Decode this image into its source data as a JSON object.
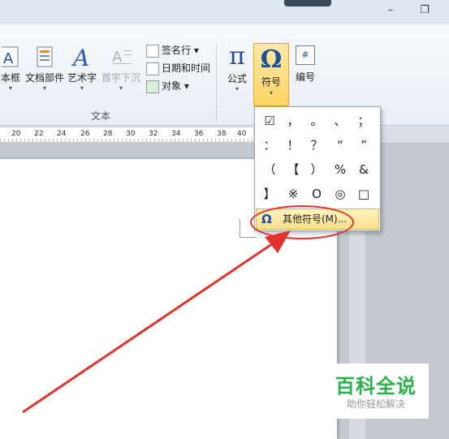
{
  "window": {
    "minimize_glyph": "–",
    "restore_glyph": "❐"
  },
  "ribbon": {
    "buttons": [
      {
        "label": "本框",
        "icon": "textbox-icon"
      },
      {
        "label": "文档部件",
        "icon": "doc-parts-icon"
      },
      {
        "label": "艺术字",
        "icon": "wordart-icon"
      },
      {
        "label": "首字下沉",
        "icon": "dropcap-icon"
      }
    ],
    "small_items": [
      {
        "label": "签名行 ▾",
        "icon": "signature-icon"
      },
      {
        "label": "日期和时间",
        "icon": "datetime-icon"
      },
      {
        "label": "对象 ▾",
        "icon": "object-icon"
      }
    ],
    "group_text_label": "文本",
    "formula": {
      "label": "公式",
      "glyph": "π"
    },
    "symbol": {
      "label": "符号",
      "glyph": "Ω"
    },
    "number": {
      "label": "编号",
      "glyph": "#"
    },
    "drop_arrow": "▾"
  },
  "ruler": {
    "ticks": [
      "20",
      "22",
      "24",
      "26",
      "28",
      "30",
      "32",
      "34",
      "36",
      "38",
      "40"
    ]
  },
  "symbol_menu": {
    "symbols": [
      "☑",
      "，",
      "。",
      "、",
      "；",
      "：",
      "！",
      "？",
      "“",
      "”",
      "（",
      "【",
      "）",
      "%",
      "&",
      "】",
      "※",
      "О",
      "◎",
      "□"
    ],
    "more_label": "其他符号(M)...",
    "more_glyph": "Ω"
  },
  "watermark": {
    "title": "百科全说",
    "subtitle": "助你轻松解决"
  },
  "colors": {
    "annotation": "#e0342f",
    "highlight": "#ffd464",
    "brand": "#2bb04a"
  }
}
